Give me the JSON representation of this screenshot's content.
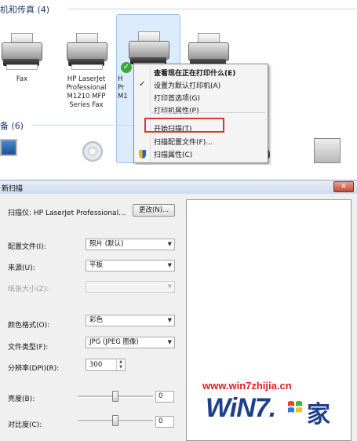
{
  "devices_panel": {
    "printers_header": "机和传真 (4)",
    "devices_header": "备 (6)",
    "devices": [
      {
        "lines": [
          "Fax"
        ]
      },
      {
        "lines": [
          "HP LaserJet",
          "Professional",
          "M1210 MFP",
          "Series Fax"
        ]
      },
      {
        "lines": [
          "H",
          "Pr",
          "M1"
        ]
      }
    ]
  },
  "context_menu": {
    "items": [
      {
        "label": "查看现在正在打印什么(E)",
        "bold": true
      },
      {
        "label": "设置为默认打印机(A)",
        "checked": true
      },
      {
        "label": "打印首选项(G)"
      },
      {
        "label": "打印机属性(P)"
      },
      {
        "label": "开始扫描(T)",
        "highlighted": true
      },
      {
        "label": "扫描配置文件(F)..."
      },
      {
        "label": "扫描属性(C)",
        "icon": "shield-icon"
      }
    ]
  },
  "scan_dialog": {
    "title": "新扫描",
    "close_glyph": "✕",
    "scanner_label": "扫描仪: HP LaserJet Professional...",
    "change_button": "更改(N)...",
    "profile_label": "配置文件(I):",
    "profile_value": "照片 (默认)",
    "source_label": "来源(U):",
    "source_value": "平板",
    "paper_size_label": "纸张大小(Z):",
    "paper_size_value": "",
    "color_format_label": "颜色格式(O):",
    "color_format_value": "彩色",
    "file_type_label": "文件类型(F):",
    "file_type_value": "JPG (JPEG 图像)",
    "resolution_label": "分辨率(DPI)(R):",
    "resolution_value": "300",
    "brightness_label": "亮度(B):",
    "brightness_value": "0",
    "brightness_level": 0.5,
    "contrast_label": "对比度(C):",
    "contrast_value": "0",
    "contrast_level": 0.5
  },
  "watermark": {
    "url": "www.win7zhijia.cn",
    "logo_text": "WiN7.",
    "logo_suffix": "家"
  }
}
